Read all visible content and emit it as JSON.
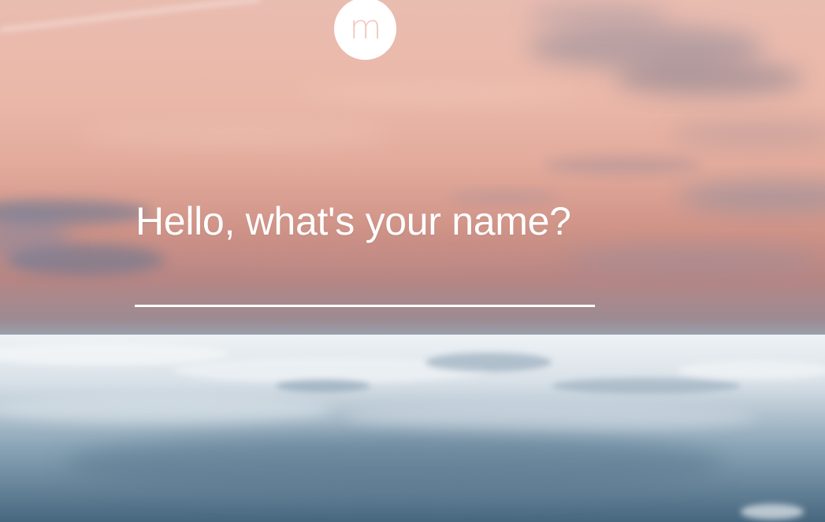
{
  "logo": {
    "letter": "m"
  },
  "greeting": {
    "prompt": "Hello, what's your name?"
  },
  "name_input": {
    "value": "",
    "placeholder": ""
  },
  "colors": {
    "prompt_text": "#ffffff",
    "input_underline": "#ffffff",
    "logo_background": "#ffffff",
    "logo_letter": "#f2c9bf"
  }
}
